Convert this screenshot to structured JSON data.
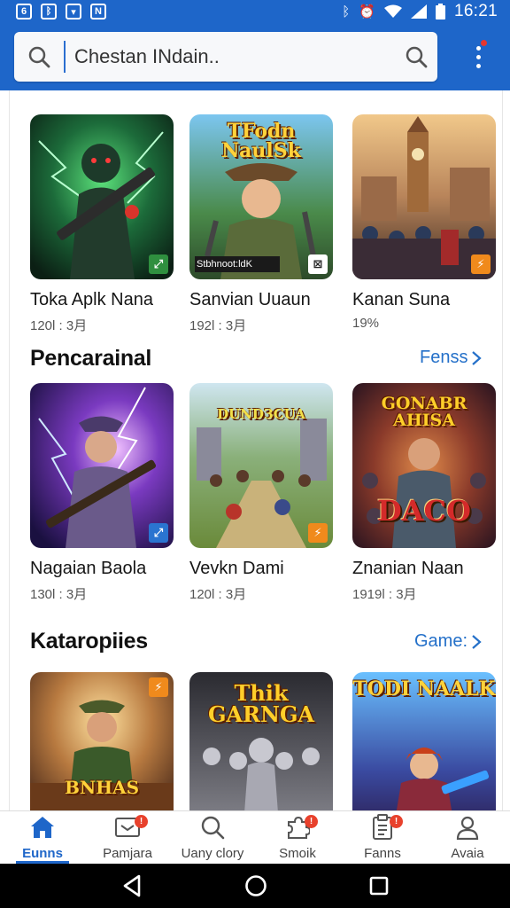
{
  "status_bar": {
    "left_icons": [
      "notification-icon",
      "messenger-icon",
      "download-icon",
      "news-icon"
    ],
    "left_glyphs": [
      "6",
      "ᛒ",
      "▾",
      "N"
    ],
    "right_icons": [
      "bluetooth-icon",
      "alarm-icon",
      "wifi-icon",
      "signal-icon",
      "battery-icon"
    ],
    "time": "16:21"
  },
  "search": {
    "value": "Chestan INdain.."
  },
  "sections": [
    {
      "title": "",
      "link": "",
      "cards": [
        {
          "name": "Toka Aplk Nana",
          "meta": "120l : 3月",
          "thumb_text": "",
          "badge": "⤢"
        },
        {
          "name": "Sanvian Uuaun",
          "meta": "192l : 3月",
          "thumb_text": "TFodn NaulSk",
          "overlay_text": "Stbhnoot:ldK",
          "badge": "⊠"
        },
        {
          "name": "Kanan Suna",
          "meta": "19%",
          "thumb_text": "",
          "badge": "⚡"
        }
      ]
    },
    {
      "title": "Pencarainal",
      "link": "Fenss",
      "cards": [
        {
          "name": "Nagaian Baola",
          "meta": "130l : 3月",
          "thumb_text": "",
          "badge": "⤢"
        },
        {
          "name": "Vevkn Dami",
          "meta": "120l : 3月",
          "thumb_text": "DUNDЗCUA",
          "badge": "⚡"
        },
        {
          "name": "Znanian Naan",
          "meta": "1919l : 3月",
          "thumb_text": "GONABR AHISA",
          "thumb_text2": "DACO",
          "badge": ""
        }
      ]
    },
    {
      "title": "Kataropiies",
      "link": "Game:",
      "cards": [
        {
          "name": "",
          "meta": "",
          "thumb_text": "BNHAS",
          "badge": "⚡"
        },
        {
          "name": "",
          "meta": "",
          "thumb_text": "Thik GARNGA",
          "badge": "⊠"
        },
        {
          "name": "",
          "meta": "",
          "thumb_text": "TODI NAALK",
          "badge": "⚡"
        }
      ]
    }
  ],
  "bottom_nav": [
    {
      "label": "Eunns",
      "icon": "home-icon",
      "active": true,
      "badge": ""
    },
    {
      "label": "Pamjara",
      "icon": "inbox-icon",
      "active": false,
      "badge": "!"
    },
    {
      "label": "Uany clory",
      "icon": "search-icon",
      "active": false,
      "badge": ""
    },
    {
      "label": "Smoik",
      "icon": "puzzle-icon",
      "active": false,
      "badge": "!"
    },
    {
      "label": "Fanns",
      "icon": "clipboard-icon",
      "active": false,
      "badge": "!"
    },
    {
      "label": "Avaia",
      "icon": "profile-icon",
      "active": false,
      "badge": ""
    }
  ],
  "colors": {
    "primary": "#1e66c9",
    "link": "#2470c9",
    "badge": "#e8412c"
  }
}
